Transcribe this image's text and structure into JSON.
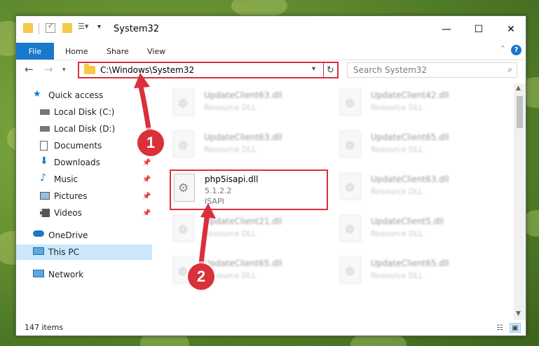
{
  "window": {
    "title": "System32"
  },
  "ribbon": {
    "tabs": [
      "File",
      "Home",
      "Share",
      "View"
    ],
    "help": "?"
  },
  "address": {
    "path": "C:\\Windows\\System32"
  },
  "search": {
    "placeholder": "Search System32"
  },
  "sidebar": {
    "items": [
      {
        "label": "Quick access",
        "icon": "star-icon",
        "pinned": false
      },
      {
        "label": "Local Disk (C:)",
        "icon": "drive-icon",
        "pinned": false
      },
      {
        "label": "Local Disk (D:)",
        "icon": "drive-icon",
        "pinned": false
      },
      {
        "label": "Documents",
        "icon": "documents-icon",
        "pinned": false
      },
      {
        "label": "Downloads",
        "icon": "download-icon",
        "pinned": true
      },
      {
        "label": "Music",
        "icon": "music-icon",
        "pinned": true
      },
      {
        "label": "Pictures",
        "icon": "pictures-icon",
        "pinned": true
      },
      {
        "label": "Videos",
        "icon": "videos-icon",
        "pinned": true
      },
      {
        "label": "OneDrive",
        "icon": "cloud-icon",
        "pinned": false
      },
      {
        "label": "This PC",
        "icon": "computer-icon",
        "pinned": false
      },
      {
        "label": "Network",
        "icon": "network-icon",
        "pinned": false
      }
    ]
  },
  "files": [
    {
      "name": "UpdateClient63.dll",
      "type": "Resource DLL"
    },
    {
      "name": "UpdateClient42.dll",
      "type": "Resource DLL"
    },
    {
      "name": "UpdateClient63.dll",
      "type": "Resource DLL"
    },
    {
      "name": "UpdateClient65.dll",
      "type": "Resource DLL"
    },
    {
      "name": "UpdateClient63.dll",
      "type": "Resource DLL"
    },
    {
      "name": "UpdateClient21.dll",
      "type": "Resource DLL"
    },
    {
      "name": "UpdateClient5.dll",
      "type": "Resource DLL"
    },
    {
      "name": "UpdateClient65.dll",
      "type": "Resource DLL"
    },
    {
      "name": "UpdateClient65.dll",
      "type": "Resource DLL"
    }
  ],
  "highlighted_file": {
    "name": "php5isapi.dll",
    "version": "5.1.2.2",
    "description": "ISAPI"
  },
  "status": {
    "item_count": "147 items"
  },
  "callouts": [
    "1",
    "2"
  ],
  "colors": {
    "accent": "#1979ca",
    "highlight_red": "#d9303a",
    "selected_bg": "#cce8ff"
  }
}
